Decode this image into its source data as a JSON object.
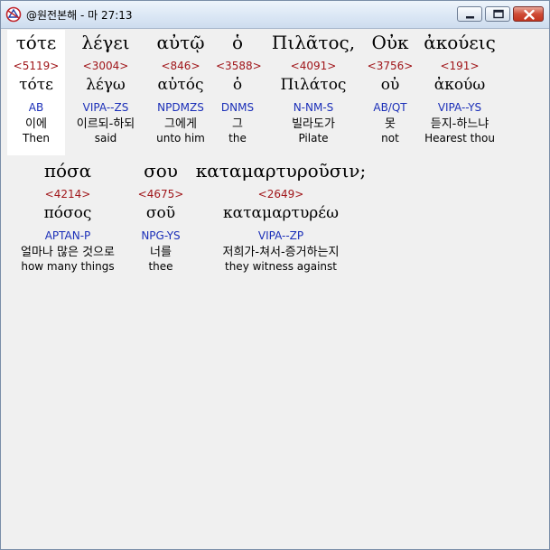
{
  "window": {
    "title": "@원전본해 - 마 27:13",
    "icon": "bible-app-icon"
  },
  "rows": [
    {
      "words": [
        {
          "greek": "τότε",
          "strong": "<5119>",
          "lemma": "τότε",
          "parsing": "AB",
          "korean": "이에",
          "english": "Then",
          "selected": true
        },
        {
          "greek": "λέγει",
          "strong": "<3004>",
          "lemma": "λέγω",
          "parsing": "VIPA--ZS",
          "korean": "이르되-하되",
          "english": "said"
        },
        {
          "greek": "αὐτῷ",
          "strong": "<846>",
          "lemma": "αὐτός",
          "parsing": "NPDMZS",
          "korean": "그에게",
          "english": "unto him"
        },
        {
          "greek": "ὁ",
          "strong": "<3588>",
          "lemma": "ὁ",
          "parsing": "DNMS",
          "korean": "그",
          "english": "the"
        },
        {
          "greek": "Πιλᾶτος,",
          "strong": "<4091>",
          "lemma": "Πιλάτος",
          "parsing": "N-NM-S",
          "korean": "빌라도가",
          "english": "Pilate"
        },
        {
          "greek": "Οὐκ",
          "strong": "<3756>",
          "lemma": "οὐ",
          "parsing": "AB/QT",
          "korean": "못",
          "english": "not"
        },
        {
          "greek": "ἀκούεις",
          "strong": "<191>",
          "lemma": "ἀκούω",
          "parsing": "VIPA--YS",
          "korean": "듣지-하느냐",
          "english": "Hearest thou"
        }
      ]
    },
    {
      "words": [
        {
          "greek": "πόσα",
          "strong": "<4214>",
          "lemma": "πόσος",
          "parsing": "APTAN-P",
          "korean": "얼마나 많은 것으로",
          "english": "how many things"
        },
        {
          "greek": "σου",
          "strong": "<4675>",
          "lemma": "σοῦ",
          "parsing": "NPG-YS",
          "korean": "너를",
          "english": "thee"
        },
        {
          "greek": "καταμαρτυροῦσιν;",
          "strong": "<2649>",
          "lemma": "καταμαρτυρέω",
          "parsing": "VIPA--ZP",
          "korean": "저희가-쳐서-증거하는지",
          "english": "they witness against"
        }
      ]
    }
  ]
}
